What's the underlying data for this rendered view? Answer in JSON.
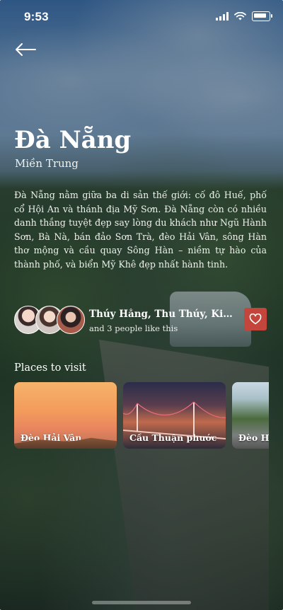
{
  "status_bar": {
    "time": "9:53"
  },
  "header": {
    "back_icon": "arrow-left-icon",
    "title": "Đà Nẵng",
    "subtitle": "Miền Trung"
  },
  "description": "Đà Nẵng nằm giữa ba di sản thế giới: cố đô Huế, phố cổ Hội An và thánh địa Mỹ Sơn. Đà Nẵng còn có nhiều danh thắng tuyệt đẹp say lòng du khách như Ngũ Hành Sơn, Bà Nà, bán đảo Sơn Trà, đèo Hải Vân, sông Hàn thơ mộng và cầu quay Sông Hàn – niềm tự hào của thành phố, và biển Mỹ Khê đẹp nhất hành tinh.",
  "likes": {
    "names": "Thúy Hằng, Thu Thúy, Kiều N...",
    "count_text": "and 3 people like this",
    "heart_icon": "heart-icon",
    "heart_color": "#c4453b"
  },
  "places": {
    "title": "Places to visit",
    "items": [
      {
        "label": "Đèo Hải Vân"
      },
      {
        "label": "Cầu Thuận phước"
      },
      {
        "label": "Đèo Hả"
      }
    ]
  }
}
